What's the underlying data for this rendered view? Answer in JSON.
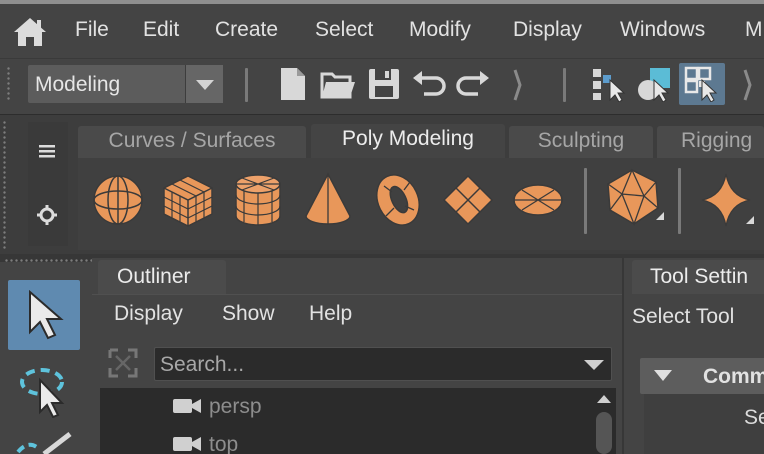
{
  "menubar": {
    "items": [
      "File",
      "Edit",
      "Create",
      "Select",
      "Modify",
      "Display",
      "Windows",
      "M"
    ]
  },
  "statusline": {
    "menu_set": "Modeling",
    "icons": [
      "new-scene-icon",
      "open-scene-icon",
      "save-scene-icon",
      "undo-icon",
      "redo-icon",
      "select-hierarchy-icon",
      "select-object-icon",
      "select-component-icon"
    ]
  },
  "shelf": {
    "tabs": [
      "Curves / Surfaces",
      "Poly Modeling",
      "Sculpting",
      "Rigging"
    ],
    "active_tab": "Poly Modeling",
    "icons": [
      "poly-sphere-icon",
      "poly-cube-icon",
      "poly-cylinder-icon",
      "poly-cone-icon",
      "poly-torus-icon",
      "poly-plane-icon",
      "poly-disc-icon",
      "platonic-solid-icon",
      "super-shape-icon"
    ],
    "accent_color": "#e8975a"
  },
  "outliner": {
    "tab_label": "Outliner",
    "menu": [
      "Display",
      "Show",
      "Help"
    ],
    "search_placeholder": "Search...",
    "items": [
      "persp",
      "top"
    ]
  },
  "tool_settings": {
    "tab_label": "Tool Settin",
    "subtitle": "Select Tool",
    "frame_label": "Comm",
    "frame_text": "Se"
  }
}
